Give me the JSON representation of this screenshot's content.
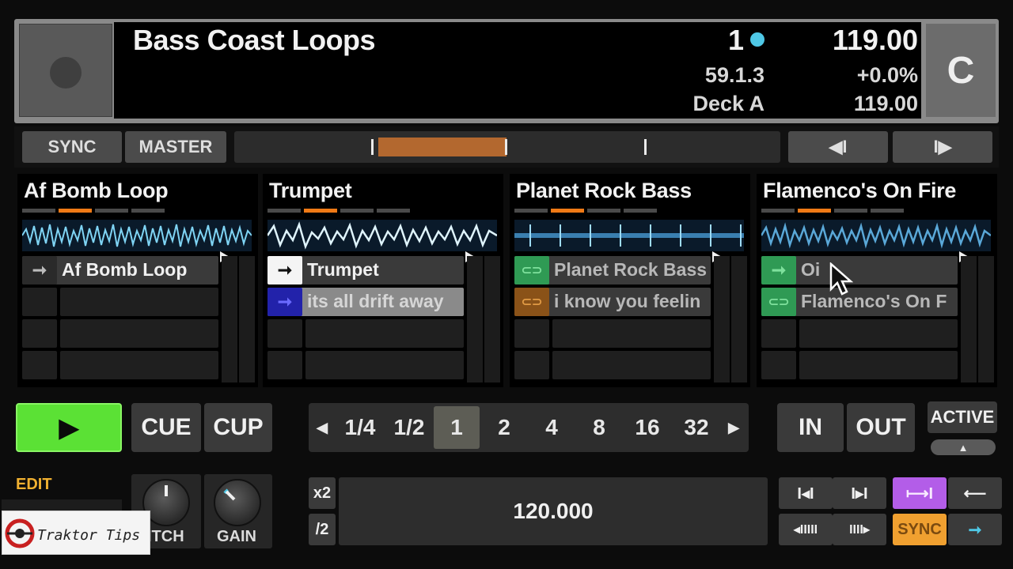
{
  "deck": {
    "title": "Bass Coast Loops",
    "deck_number": "1",
    "bpm": "119.00",
    "position": "59.1.3",
    "pitch_percent": "+0.0%",
    "deck_name": "Deck A",
    "tempo": "119.00",
    "deck_letter": "C",
    "status_dot_color": "#4fc8e6"
  },
  "transport": {
    "sync_label": "SYNC",
    "master_label": "MASTER",
    "prev_icon": "skip-back-icon",
    "next_icon": "skip-forward-icon",
    "prev_glyph": "◀I",
    "next_glyph": "I▶",
    "loop_color": "#b3682f"
  },
  "slots": [
    {
      "title": "Af Bomb Loop",
      "cells": [
        {
          "label": "Af Bomb Loop",
          "icon": "one-shot-arrow-icon",
          "glyph": "➞"
        }
      ]
    },
    {
      "title": "Trumpet",
      "cells": [
        {
          "label": "Trumpet",
          "icon": "one-shot-arrow-icon",
          "glyph": "➞"
        },
        {
          "label": "its all drift away",
          "icon": "one-shot-arrow-icon",
          "glyph": "➞"
        }
      ]
    },
    {
      "title": "Planet Rock Bass",
      "cells": [
        {
          "label": "Planet Rock Bass",
          "icon": "loop-icon",
          "glyph": "⊂⊃"
        },
        {
          "label": "i know you feelin",
          "icon": "loop-icon",
          "glyph": "⊂⊃"
        }
      ]
    },
    {
      "title": "Flamenco's On Fire",
      "cells": [
        {
          "label": "Oi",
          "icon": "one-shot-arrow-icon",
          "glyph": "➞"
        },
        {
          "label": "Flamenco's On F",
          "icon": "loop-icon",
          "glyph": "⊂⊃"
        }
      ]
    }
  ],
  "controls": {
    "play_glyph": "▶",
    "cue_label": "CUE",
    "cup_label": "CUP",
    "beats": [
      "1/4",
      "1/2",
      "1",
      "2",
      "4",
      "8",
      "16",
      "32"
    ],
    "selected_beat": "1",
    "beat_prev_glyph": "◀",
    "beat_next_glyph": "▶",
    "in_label": "IN",
    "out_label": "OUT",
    "active_label": "ACTIVE",
    "active_up_glyph": "▲",
    "play_color": "#5be135"
  },
  "bottom": {
    "edit_label": "EDIT",
    "pitch_label": "ITCH",
    "gain_label": "GAIN",
    "x2_label": "x2",
    "div2_label": "/2",
    "bpm_value": "120.000",
    "sync_label": "SYNC",
    "glyph_loop_in": "I◂I",
    "glyph_loop_out": "I▸I",
    "glyph_purple": "⟼I",
    "glyph_back": "⟵",
    "glyph_beat_left": "◂IIIII",
    "glyph_beat_right": "IIII▸",
    "glyph_forward": "➞",
    "logo_text": "Traktor Tips"
  }
}
